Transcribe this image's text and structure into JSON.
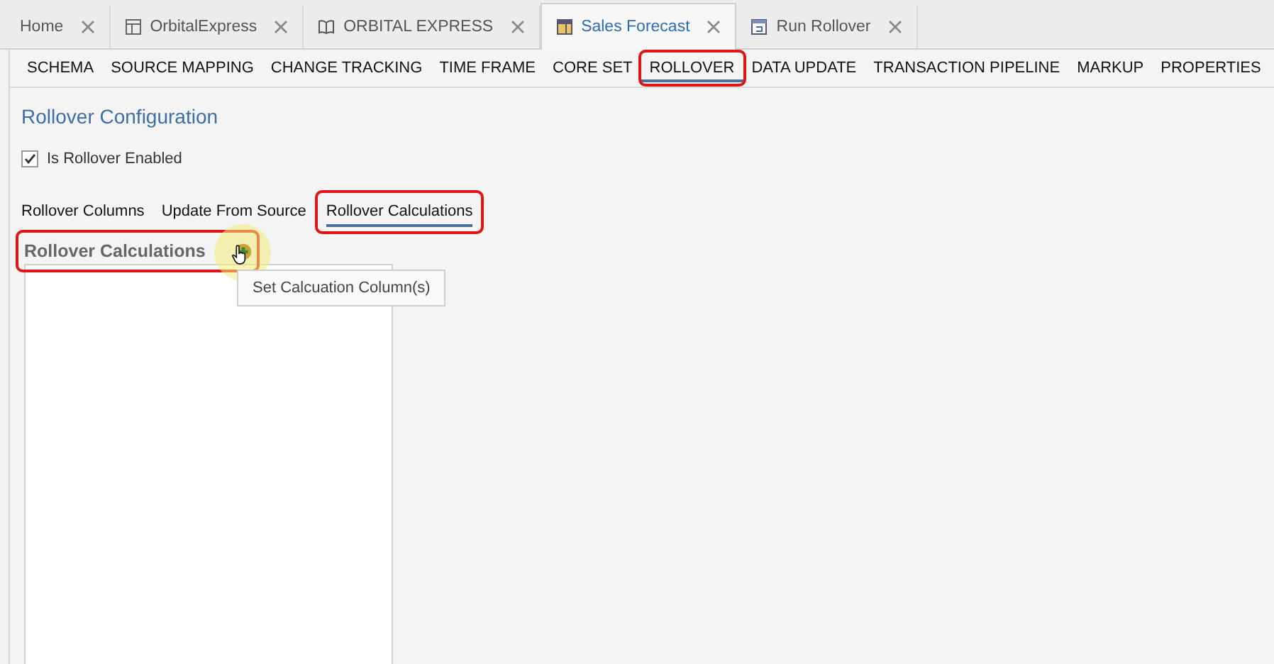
{
  "doc_tabs": [
    {
      "label": "Home",
      "selected": false
    },
    {
      "label": "OrbitalExpress",
      "selected": false
    },
    {
      "label": "ORBITAL EXPRESS",
      "selected": false
    },
    {
      "label": "Sales Forecast",
      "selected": true
    },
    {
      "label": "Run Rollover",
      "selected": false
    }
  ],
  "nav": [
    {
      "label": "SCHEMA",
      "selected": false,
      "highlighted": false
    },
    {
      "label": "SOURCE MAPPING",
      "selected": false,
      "highlighted": false
    },
    {
      "label": "CHANGE TRACKING",
      "selected": false,
      "highlighted": false
    },
    {
      "label": "TIME FRAME",
      "selected": false,
      "highlighted": false
    },
    {
      "label": "CORE SET",
      "selected": false,
      "highlighted": false
    },
    {
      "label": "ROLLOVER",
      "selected": true,
      "highlighted": true
    },
    {
      "label": "DATA UPDATE",
      "selected": false,
      "highlighted": false
    },
    {
      "label": "TRANSACTION PIPELINE",
      "selected": false,
      "highlighted": false
    },
    {
      "label": "MARKUP",
      "selected": false,
      "highlighted": false
    },
    {
      "label": "PROPERTIES",
      "selected": false,
      "highlighted": false
    }
  ],
  "title": "Rollover Configuration",
  "enabled": {
    "label": "Is Rollover Enabled",
    "checked": true
  },
  "sub_tabs": [
    {
      "label": "Rollover Columns",
      "selected": false,
      "highlighted": false
    },
    {
      "label": "Update From Source",
      "selected": false,
      "highlighted": false
    },
    {
      "label": "Rollover Calculations",
      "selected": true,
      "highlighted": true
    }
  ],
  "section": {
    "title": "Rollover Calculations",
    "highlighted": true
  },
  "tooltip": "Set Calcuation Column(s)"
}
